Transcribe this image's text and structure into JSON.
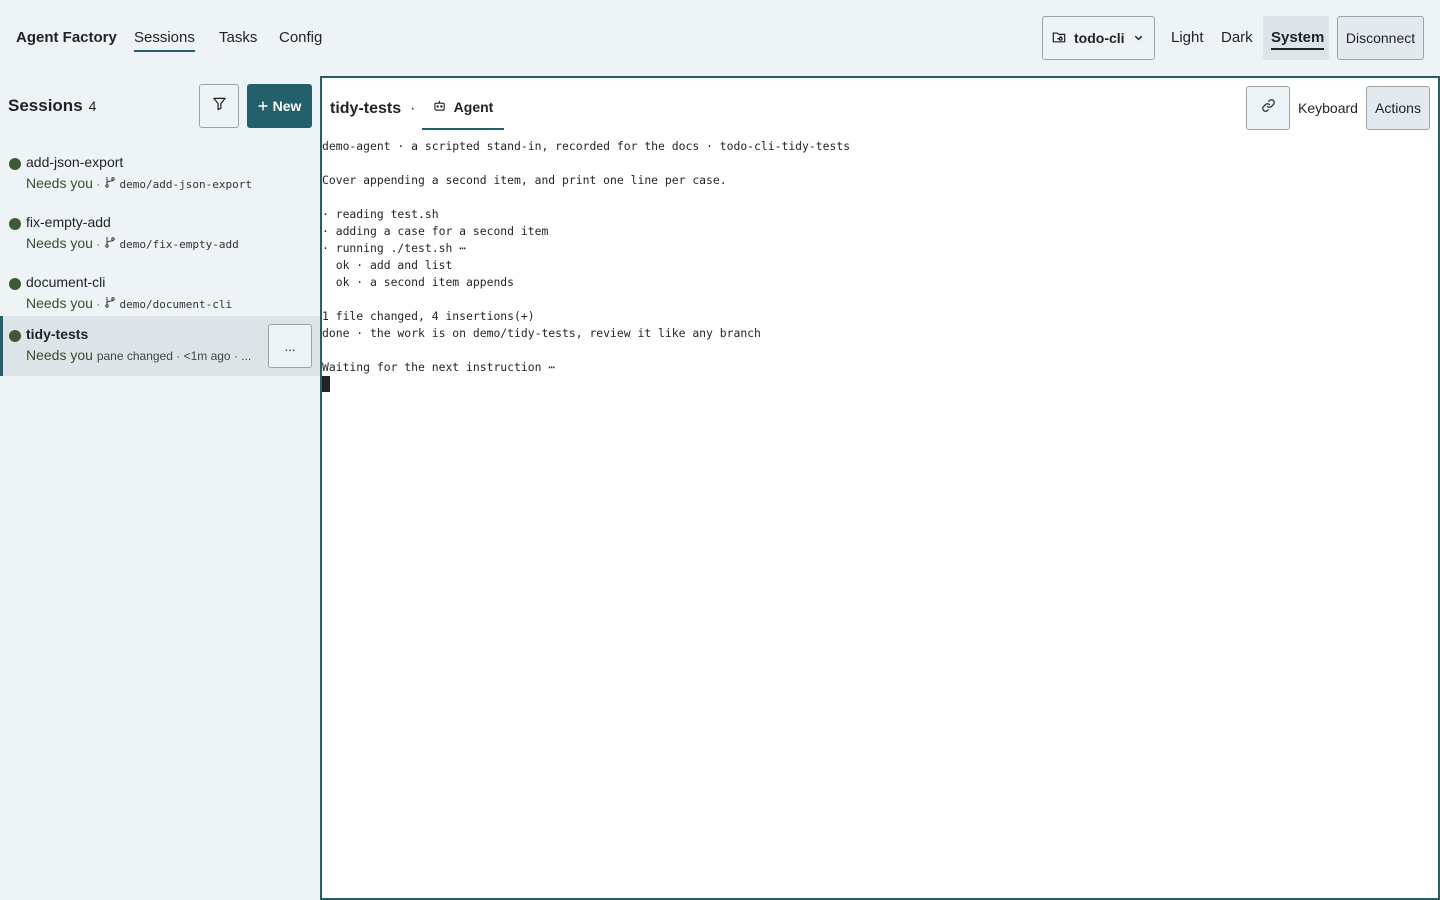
{
  "header": {
    "brand": "Agent Factory",
    "nav": [
      {
        "label": "Sessions",
        "active": true
      },
      {
        "label": "Tasks",
        "active": false
      },
      {
        "label": "Config",
        "active": false
      }
    ],
    "project": {
      "label": "todo-cli",
      "icon": "folder-git-icon"
    },
    "theme": {
      "light": "Light",
      "dark": "Dark",
      "system": "System",
      "selected": "System"
    },
    "disconnect_label": "Disconnect"
  },
  "sidebar": {
    "title": "Sessions",
    "count": "4",
    "new_label": "New",
    "sessions": [
      {
        "name": "add-json-export",
        "status": "Needs you",
        "branch": "demo/add-json-export",
        "selected": false
      },
      {
        "name": "fix-empty-add",
        "status": "Needs you",
        "branch": "demo/fix-empty-add",
        "selected": false
      },
      {
        "name": "document-cli",
        "status": "Needs you",
        "branch": "demo/document-cli",
        "selected": false
      },
      {
        "name": "tidy-tests",
        "status": "Needs you",
        "meta": "pane changed · <1m ago · ...",
        "more_label": "...",
        "selected": true
      }
    ]
  },
  "pane": {
    "title": "tidy-tests",
    "separator": "·",
    "tab_label": "Agent",
    "keyboard_label": "Keyboard",
    "actions_label": "Actions",
    "terminal_lines": [
      "demo-agent · a scripted stand-in, recorded for the docs · todo-cli-tidy-tests",
      "",
      "Cover appending a second item, and print one line per case.",
      "",
      "· reading test.sh",
      "· adding a case for a second item",
      "· running ./test.sh ⋯",
      "  ok · add and list",
      "  ok · a second item appends",
      "",
      "1 file changed, 4 insertions(+)",
      "done · the work is on demo/tidy-tests, review it like any branch",
      "",
      "Waiting for the next instruction ⋯"
    ]
  },
  "colors": {
    "accent": "#24606b",
    "status_dot": "#3e5a34",
    "background": "#eef3f5"
  }
}
